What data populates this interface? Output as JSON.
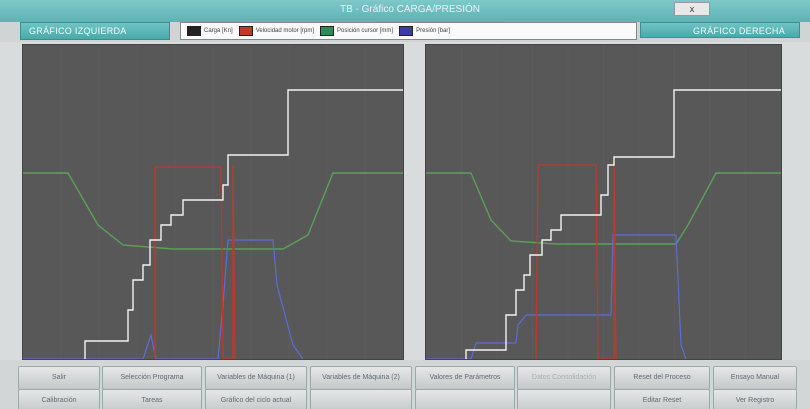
{
  "window": {
    "title": "TB - Gráfico CARGA/PRESIÓN",
    "close_label": "x"
  },
  "header": {
    "left_graph": "GRÁFICO IZQUIERDA",
    "right_graph": "GRÁFICO DERECHA",
    "legend": [
      {
        "label": "Carga [Kn]",
        "color": "#ffffff"
      },
      {
        "label": "Velocidad motor [rpm]",
        "color": "#c0392b"
      },
      {
        "label": "Posición cursor [mm]",
        "color": "#2e8b57"
      },
      {
        "label": "Presión [bar]",
        "color": "#3a3aa8"
      }
    ]
  },
  "colors": {
    "white": "#f2f2f2",
    "red": "#c0392b",
    "green": "#5aa05a",
    "blue": "#5b6ed6",
    "plot_bg": "#585858"
  },
  "buttons_row1": [
    {
      "label": "Salir",
      "enabled": true
    },
    {
      "label": "Selección Programa",
      "enabled": true
    },
    {
      "label": "Variables de Máquina (1)",
      "enabled": true
    },
    {
      "label": "Variables de Máquina (2)",
      "enabled": true
    },
    {
      "label": "Valores de Parámetros",
      "enabled": true
    },
    {
      "label": "Datos Consolidación",
      "enabled": false
    },
    {
      "label": "Reset del Proceso",
      "enabled": true
    },
    {
      "label": "Ensayo Manual",
      "enabled": true
    }
  ],
  "buttons_row2": [
    {
      "label": "Calibración",
      "enabled": true
    },
    {
      "label": "Tareas",
      "enabled": true
    },
    {
      "label": "Gráfico del ciclo actual",
      "enabled": true
    },
    {
      "label": "",
      "enabled": true
    },
    {
      "label": "",
      "enabled": true
    },
    {
      "label": "",
      "enabled": true
    },
    {
      "label": "Editar Reset",
      "enabled": true
    },
    {
      "label": "Ver Registro",
      "enabled": true
    }
  ]
}
